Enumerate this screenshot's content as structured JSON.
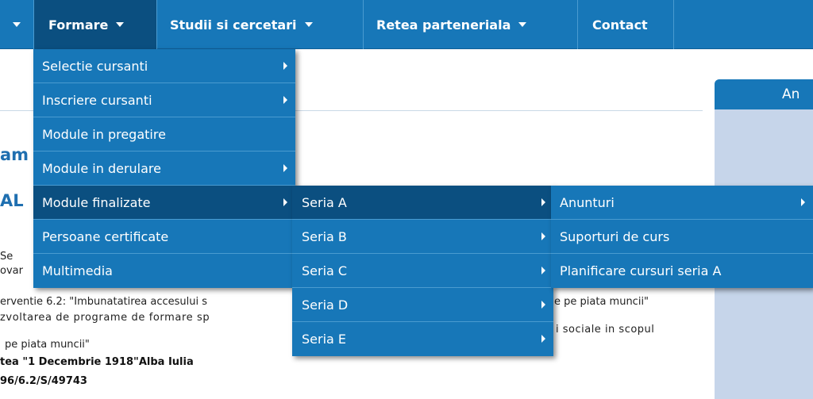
{
  "nav": {
    "items": [
      {
        "label": "Formare"
      },
      {
        "label": "Studii si cercetari"
      },
      {
        "label": "Retea parteneriala"
      },
      {
        "label": "Contact"
      }
    ]
  },
  "menu_formare": {
    "items": [
      {
        "label": "Selectie cursanti"
      },
      {
        "label": "Inscriere cursanti"
      },
      {
        "label": "Module in pregatire"
      },
      {
        "label": "Module in derulare"
      },
      {
        "label": "Module finalizate"
      },
      {
        "label": "Persoane certificate"
      },
      {
        "label": "Multimedia"
      }
    ]
  },
  "menu_serii": {
    "items": [
      {
        "label": "Seria A"
      },
      {
        "label": "Seria B"
      },
      {
        "label": "Seria C"
      },
      {
        "label": "Seria D"
      },
      {
        "label": "Seria E"
      }
    ]
  },
  "menu_seria_a": {
    "items": [
      {
        "label": "Anunturi"
      },
      {
        "label": "Suporturi de curs"
      },
      {
        "label": "Planificare cursuri seria A"
      }
    ]
  },
  "content": {
    "frag_am": "am",
    "frag_al": "AL",
    "frag_se": "Se",
    "frag_ovar": "ovar",
    "line1_left": "erventie 6.2: \"Imbunatatirea accesului s",
    "line1_right": "e pe piata muncii\"",
    "line2_left": "zvoltarea de programe de formare sp",
    "line2_right": "i sociale in scopul",
    "line3": "pe piata muncii\"",
    "line4": "tea \"1 Decembrie 1918\"Alba Iulia",
    "line5": "96/6.2/S/49743"
  },
  "right_panel": {
    "title": "An"
  },
  "colors": {
    "menu_bg": "#1777b8",
    "menu_highlight": "#0b4f80",
    "panel_bg": "#c6d5ea"
  }
}
